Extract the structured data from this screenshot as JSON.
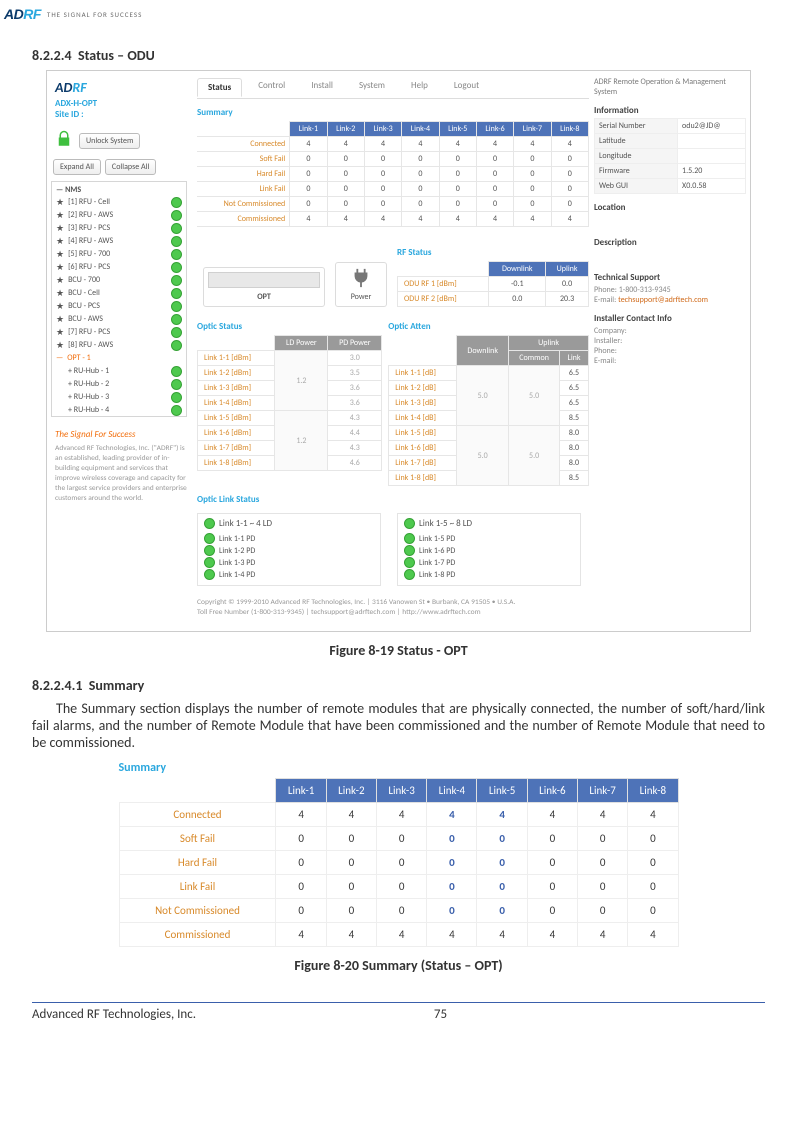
{
  "header": {
    "logo_left": "AD",
    "logo_right": "RF",
    "logo_tag": "THE SIGNAL FOR SUCCESS"
  },
  "section1": {
    "num": "8.2.2.4",
    "title": "Status – ODU"
  },
  "figure1_caption": "Figure 8-19   Status - OPT",
  "shot1": {
    "siteid_line1": "ADX-H-OPT",
    "siteid_line2": "Site ID :",
    "unlock_btn": "Unlock System",
    "expand_btn": "Expand All",
    "collapse_btn": "Collapse All",
    "tree": {
      "root": "NMS",
      "items": [
        "[1] RFU - Cell",
        "[2] RFU - AWS",
        "[3] RFU - PCS",
        "[4] RFU - AWS",
        "[5] RFU - 700",
        "[6] RFU - PCS",
        "BCU - 700",
        "BCU - Cell",
        "BCU - PCS",
        "BCU - AWS",
        "[7] RFU - PCS",
        "[8] RFU - AWS"
      ],
      "opt_item": "OPT - 1",
      "children": [
        "RU-Hub - 1",
        "RU-Hub - 2",
        "RU-Hub - 3",
        "RU-Hub - 4"
      ]
    },
    "slogan": "The Signal For Success",
    "blurb": "Advanced RF Technologies, Inc. (\"ADRF\") is an established, leading provider of in-building equipment and services that improve wireless coverage and capacity for the largest service providers and enterprise customers around the world.",
    "tabs": [
      "Status",
      "Control",
      "Install",
      "System",
      "Help",
      "Logout"
    ],
    "summary_title": "Summary",
    "link_headers": [
      "",
      "Link-1",
      "Link-2",
      "Link-3",
      "Link-4",
      "Link-5",
      "Link-6",
      "Link-7",
      "Link-8"
    ],
    "summary_rows": [
      {
        "label": "Connected",
        "v": [
          "4",
          "4",
          "4",
          "4",
          "4",
          "4",
          "4",
          "4"
        ]
      },
      {
        "label": "Soft Fail",
        "v": [
          "0",
          "0",
          "0",
          "0",
          "0",
          "0",
          "0",
          "0"
        ]
      },
      {
        "label": "Hard Fail",
        "v": [
          "0",
          "0",
          "0",
          "0",
          "0",
          "0",
          "0",
          "0"
        ]
      },
      {
        "label": "Link Fail",
        "v": [
          "0",
          "0",
          "0",
          "0",
          "0",
          "0",
          "0",
          "0"
        ]
      },
      {
        "label": "Not Commissioned",
        "v": [
          "0",
          "0",
          "0",
          "0",
          "0",
          "0",
          "0",
          "0"
        ]
      },
      {
        "label": "Commissioned",
        "v": [
          "4",
          "4",
          "4",
          "4",
          "4",
          "4",
          "4",
          "4"
        ]
      }
    ],
    "opt_label": "OPT",
    "power_label": "Power",
    "rf_title": "RF Status",
    "rf_headers": [
      "",
      "Downlink",
      "Uplink"
    ],
    "rf_rows": [
      {
        "label": "ODU RF 1 [dBm]",
        "d": "-0.1",
        "u": "0.0"
      },
      {
        "label": "ODU RF 2 [dBm]",
        "d": "0.0",
        "u": "20.3"
      }
    ],
    "optic_title": "Optic Status",
    "optic_headers": [
      "",
      "LD Power",
      "PD Power"
    ],
    "optic_rows": [
      {
        "label": "Link 1-1 [dBm]",
        "ld_group": "1.2",
        "pd": "3.0"
      },
      {
        "label": "Link 1-2 [dBm]",
        "pd": "3.5"
      },
      {
        "label": "Link 1-3 [dBm]",
        "pd": "3.6"
      },
      {
        "label": "Link 1-4 [dBm]",
        "pd": "3.6"
      },
      {
        "label": "Link 1-5 [dBm]",
        "ld_group": "1.2",
        "pd": "4.3"
      },
      {
        "label": "Link 1-6 [dBm]",
        "pd": "4.4"
      },
      {
        "label": "Link 1-7 [dBm]",
        "pd": "4.3"
      },
      {
        "label": "Link 1-8 [dBm]",
        "pd": "4.6"
      }
    ],
    "atten_title": "Optic Atten",
    "atten_headers_top": [
      "",
      "Downlink",
      "Uplink"
    ],
    "atten_headers_sub": [
      "",
      "",
      "Common",
      "Link"
    ],
    "atten_rows": [
      {
        "label": "Link 1-1 [dB]",
        "dl_group": "5.0",
        "uc_group": "5.0",
        "ul": "6.5"
      },
      {
        "label": "Link 1-2 [dB]",
        "ul": "6.5"
      },
      {
        "label": "Link 1-3 [dB]",
        "ul": "6.5"
      },
      {
        "label": "Link 1-4 [dB]",
        "ul": "8.5"
      },
      {
        "label": "Link 1-5 [dB]",
        "dl_group": "5.0",
        "uc_group": "5.0",
        "ul": "8.0"
      },
      {
        "label": "Link 1-6 [dB]",
        "ul": "8.0"
      },
      {
        "label": "Link 1-7 [dB]",
        "ul": "8.0"
      },
      {
        "label": "Link 1-8 [dB]",
        "ul": "8.5"
      }
    ],
    "ols_title": "Optic Link Status",
    "ols_left_head": "Link 1-1 ~ 4 LD",
    "ols_right_head": "Link 1-5 ~ 8 LD",
    "ols_left": [
      "Link 1-1 PD",
      "Link 1-2 PD",
      "Link 1-3 PD",
      "Link 1-4 PD"
    ],
    "ols_right": [
      "Link 1-5 PD",
      "Link 1-6 PD",
      "Link 1-7 PD",
      "Link 1-8 PD"
    ],
    "copyright_1": "Copyright © 1999-2010 Advanced RF Technologies, Inc. | 3116 Vanowen St • Burbank, CA 91505 • U.S.A.",
    "copyright_2": "Toll Free Number (1-800-313-9345) | techsupport@adrftech.com | http://www.adrftech.com",
    "right": {
      "head": "ADRF Remote Operation & Management System",
      "info_title": "Information",
      "info_rows": [
        {
          "k": "Serial Number",
          "v": "odu2@JD@"
        },
        {
          "k": "Latitude",
          "v": ""
        },
        {
          "k": "Longitude",
          "v": ""
        },
        {
          "k": "Firmware",
          "v": "1.5.20"
        },
        {
          "k": "Web GUI",
          "v": "X0.0.58"
        }
      ],
      "location_title": "Location",
      "description_title": "Description",
      "tech_title": "Technical Support",
      "tech_phone": "Phone: 1-800-313-9345",
      "tech_email_label": "E-mail: ",
      "tech_email": "techsupport@adrftech.com",
      "installer_title": "Installer Contact Info",
      "installer_rows": [
        "Company:",
        "Installer:",
        "Phone:",
        "E-mail:"
      ]
    }
  },
  "section2": {
    "num": "8.2.2.4.1",
    "title": "Summary"
  },
  "para1": "The Summary section displays the number of remote modules that are physically connected, the number of soft/hard/link fail alarms, and the number of Remote Module that have been commissioned and the number of Remote Module that need to be commissioned.",
  "shot2": {
    "title": "Summary",
    "headers": [
      "",
      "Link-1",
      "Link-2",
      "Link-3",
      "Link-4",
      "Link-5",
      "Link-6",
      "Link-7",
      "Link-8"
    ],
    "rows": [
      {
        "label": "Connected",
        "v": [
          "4",
          "4",
          "4",
          "4",
          "4",
          "4",
          "4",
          "4"
        ],
        "blue": [
          3,
          4
        ]
      },
      {
        "label": "Soft Fail",
        "v": [
          "0",
          "0",
          "0",
          "0",
          "0",
          "0",
          "0",
          "0"
        ],
        "blue": [
          3,
          4
        ]
      },
      {
        "label": "Hard Fail",
        "v": [
          "0",
          "0",
          "0",
          "0",
          "0",
          "0",
          "0",
          "0"
        ],
        "blue": [
          3,
          4
        ]
      },
      {
        "label": "Link Fail",
        "v": [
          "0",
          "0",
          "0",
          "0",
          "0",
          "0",
          "0",
          "0"
        ],
        "blue": [
          3,
          4
        ]
      },
      {
        "label": "Not Commissioned",
        "v": [
          "0",
          "0",
          "0",
          "0",
          "0",
          "0",
          "0",
          "0"
        ],
        "blue": [
          3,
          4
        ]
      },
      {
        "label": "Commissioned",
        "v": [
          "4",
          "4",
          "4",
          "4",
          "4",
          "4",
          "4",
          "4"
        ],
        "blue": []
      }
    ]
  },
  "figure2_caption": "Figure 8-20   Summary (Status – OPT)",
  "footer": {
    "left": "Advanced RF Technologies, Inc.",
    "page": "75"
  }
}
